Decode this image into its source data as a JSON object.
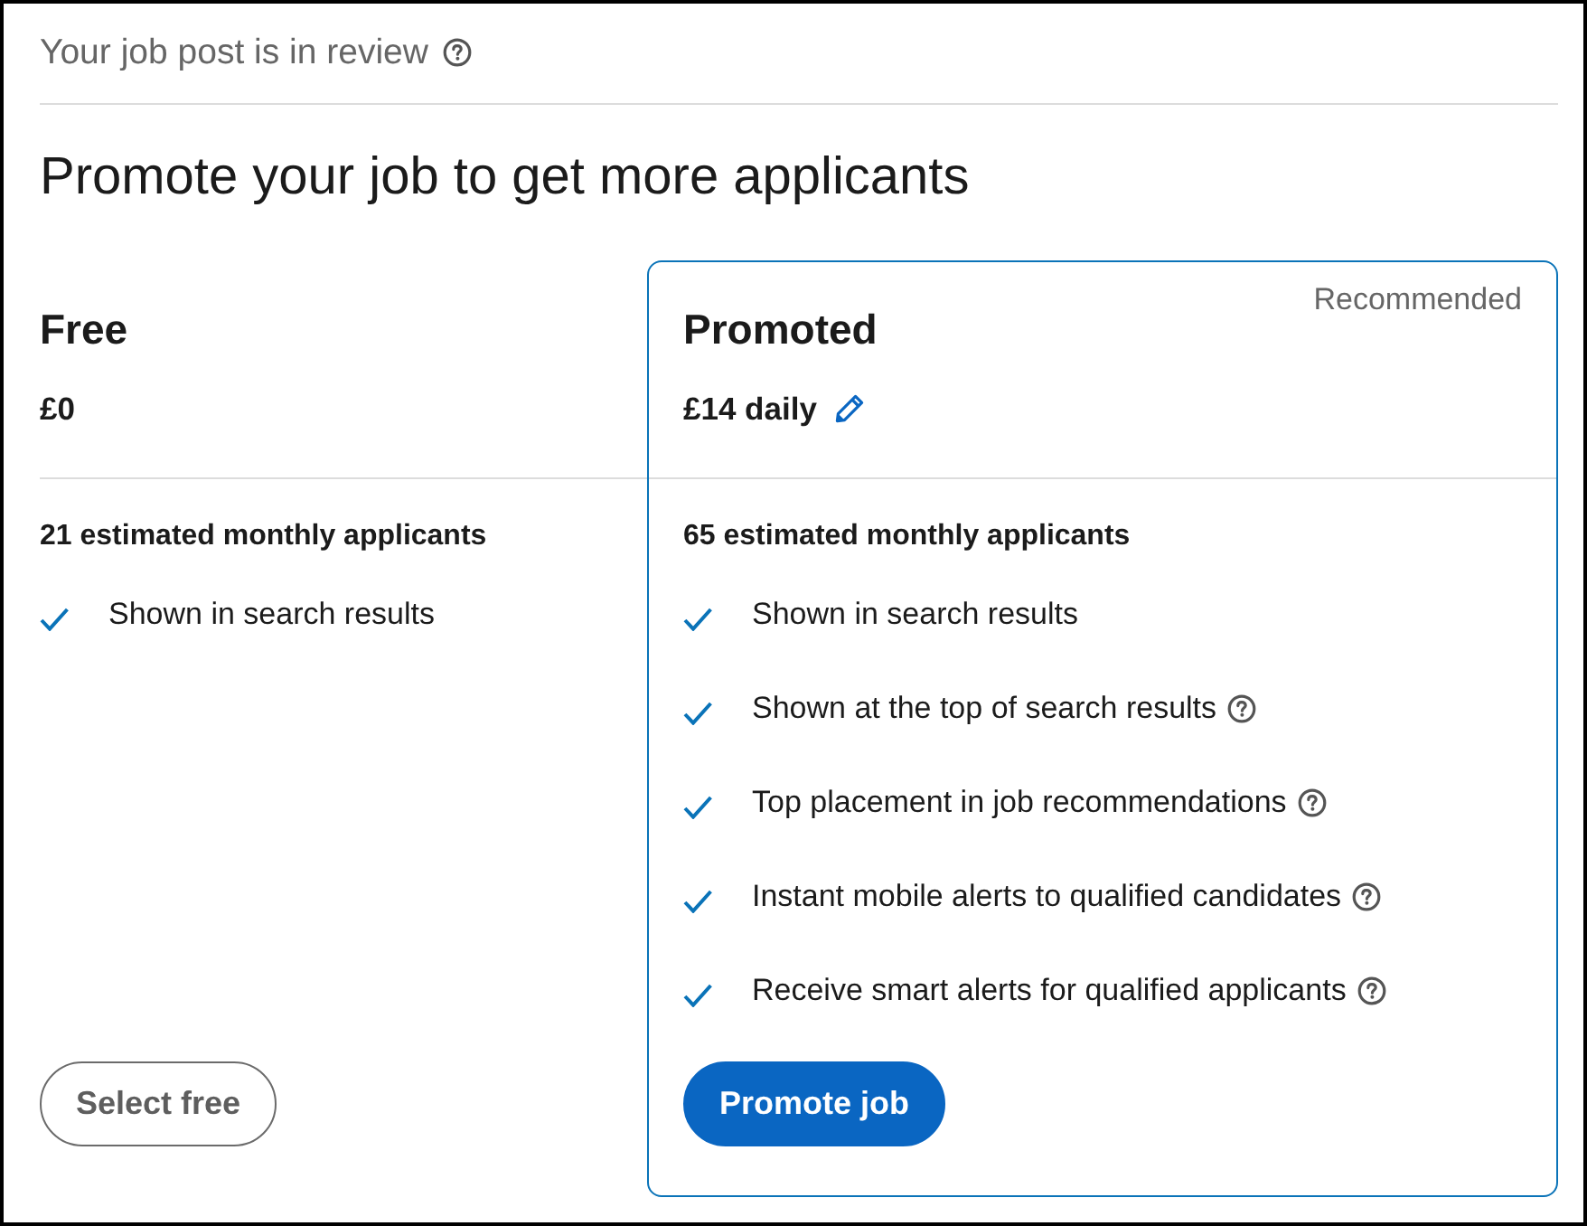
{
  "header": {
    "status": "Your job post is in review"
  },
  "title": "Promote your job to get more applicants",
  "plans": [
    {
      "name": "Free",
      "price": "£0",
      "editable": false,
      "highlighted": false,
      "applicants": "21 estimated monthly applicants",
      "features": [
        {
          "text": "Shown in search results",
          "help": false
        }
      ],
      "button": {
        "label": "Select free",
        "kind": "secondary"
      }
    },
    {
      "name": "Promoted",
      "badge": "Recommended",
      "price": "£14 daily",
      "editable": true,
      "highlighted": true,
      "applicants": "65 estimated monthly applicants",
      "features": [
        {
          "text": "Shown in search results",
          "help": false
        },
        {
          "text": "Shown at the top of search results",
          "help": true
        },
        {
          "text": "Top placement in job recommendations",
          "help": true
        },
        {
          "text": "Instant mobile alerts to qualified candidates",
          "help": true
        },
        {
          "text": "Receive smart alerts for qualified applicants",
          "help": true
        }
      ],
      "button": {
        "label": "Promote job",
        "kind": "primary"
      }
    }
  ]
}
